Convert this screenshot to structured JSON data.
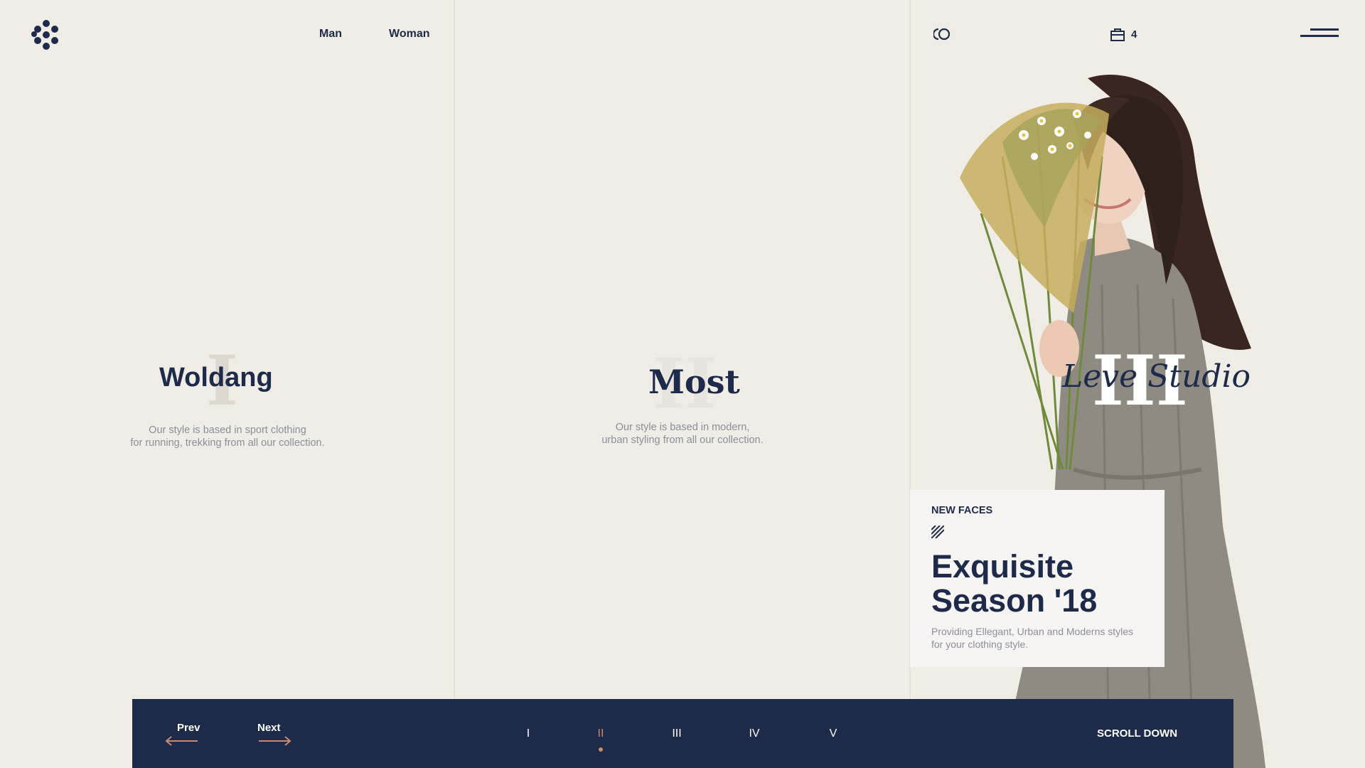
{
  "header": {
    "logo_icon": "dots-logo-icon",
    "nav": [
      {
        "label": "Man"
      },
      {
        "label": "Woman"
      }
    ],
    "search_icon": "search-icon",
    "cart_icon": "shopping-bag-icon",
    "cart_count": "4",
    "menu_icon": "hamburger-menu-icon"
  },
  "panels": [
    {
      "numeral": "I",
      "title": "Woldang",
      "desc_lines": [
        "Our style is based in sport clothing",
        "for running, trekking from all our collection."
      ]
    },
    {
      "numeral": "II",
      "title": "Most",
      "desc_lines": [
        "Our style is based in modern,",
        "urban styling from all our collection."
      ]
    },
    {
      "numeral": "III",
      "title": "Leve Studio"
    }
  ],
  "promo": {
    "eyebrow": "NEW FACES",
    "title_lines": [
      "Exquisite",
      "Season '18"
    ],
    "desc_lines": [
      "Providing Ellegant, Urban and Moderns styles",
      "for your clothing style."
    ]
  },
  "bottom_bar": {
    "prev_label": "Prev",
    "next_label": "Next",
    "pager": [
      {
        "label": "I"
      },
      {
        "label": "II",
        "active": true
      },
      {
        "label": "III"
      },
      {
        "label": "IV"
      },
      {
        "label": "V"
      }
    ],
    "scroll_label": "SCROLL DOWN"
  },
  "colors": {
    "background": "#f0ede6",
    "navy": "#1e2a4a",
    "accent": "#c58a73",
    "muted_text": "#8a8f9c"
  }
}
